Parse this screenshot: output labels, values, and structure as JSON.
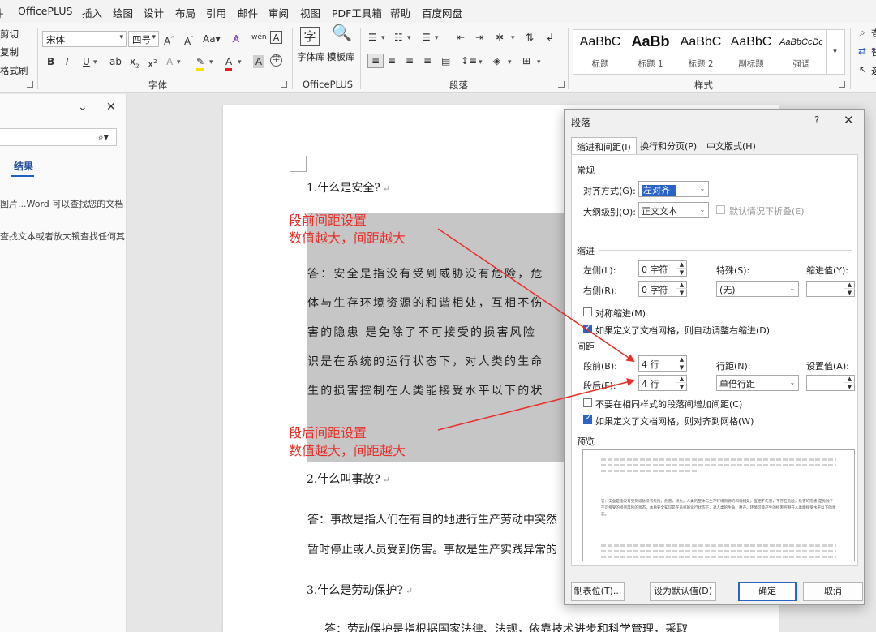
{
  "menu": [
    "件",
    "OfficePLUS",
    "插入",
    "绘图",
    "设计",
    "布局",
    "引用",
    "邮件",
    "审阅",
    "视图",
    "PDF工具箱",
    "帮助",
    "百度网盘"
  ],
  "ribbon": {
    "clipboard": {
      "cut": "剪切",
      "copy": "复制",
      "painter": "格式刷"
    },
    "font": {
      "name": "宋体",
      "size": "四号",
      "group_label": "字体",
      "aa": "Aa"
    },
    "officeplus": {
      "font_lib": "字体库",
      "template_lib": "模板库",
      "group_label": "OfficePLUS",
      "char": "字"
    },
    "paragraph": {
      "group_label": "段落"
    },
    "styles": {
      "group_label": "样式",
      "items": [
        {
          "sample": "AaBbC",
          "name": "标题"
        },
        {
          "sample": "AaBb",
          "name": "标题 1"
        },
        {
          "sample": "AaBbC",
          "name": "标题 2"
        },
        {
          "sample": "AaBbC",
          "name": "副标题"
        },
        {
          "sample": "AaBbCcDc",
          "name": "强调"
        }
      ]
    },
    "editing": {
      "find": "查",
      "replace": "替",
      "select": "选"
    }
  },
  "navpane": {
    "tab_results": "结果",
    "hint1": "图片...Word 可以查找您的文档",
    "hint2": "查找文本或者放大镜查找任何其"
  },
  "document": {
    "q1": "1.什么是安全?",
    "a1_lines": [
      "答：安全是指没有受到威胁没有危险，危",
      "体与生存环境资源的和谐相处，互相不伤",
      "害的隐患  是免除了不可接受的损害风险",
      "识是在系统的运行状态下，对人类的生命",
      "生的损害控制在人类能接受水平以下的状"
    ],
    "q2": "2.什么叫事故?",
    "a2_lines": [
      "答：事故是指人们在有目的地进行生产劳动中突然",
      "暂时停止或人员受到伤害。事故是生产实践异常的"
    ],
    "q3": "3.什么是劳动保护?",
    "a3_line": "答：劳动保护是指根据国家法律、法规，依靠技术进步和科学管理，采取",
    "return_mark": "↵"
  },
  "annotations": {
    "before": [
      "段前间距设置",
      "数值越大，间距越大"
    ],
    "after": [
      "段后间距设置",
      "数值越大，间距越大"
    ]
  },
  "dialog": {
    "title": "段落",
    "help": "?",
    "tabs": [
      "缩进和间距(I)",
      "换行和分页(P)",
      "中文版式(H)"
    ],
    "general": {
      "section": "常规",
      "align_label": "对齐方式(G):",
      "align_value": "左对齐",
      "outline_label": "大纲级别(O):",
      "outline_value": "正文文本",
      "collapse_label": "默认情况下折叠(E)"
    },
    "indent": {
      "section": "缩进",
      "left_label": "左侧(L):",
      "left_value": "0 字符",
      "right_label": "右侧(R):",
      "right_value": "0 字符",
      "special_label": "特殊(S):",
      "special_value": "(无)",
      "indent_by_label": "缩进值(Y):",
      "mirror_label": "对称缩进(M)",
      "auto_right_label": "如果定义了文档网格，则自动调整右缩进(D)"
    },
    "spacing": {
      "section": "间距",
      "before_label": "段前(B):",
      "before_value": "4 行",
      "after_label": "段后(F):",
      "after_value": "4 行",
      "line_label": "行距(N):",
      "line_value": "单倍行距",
      "at_label": "设置值(A):",
      "no_space_label": "不要在相同样式的段落间增加间距(C)",
      "snap_grid_label": "如果定义了文档网格，则对齐到网格(W)"
    },
    "preview": {
      "section": "预览",
      "sample_text": "答：安全是指没有受到威胁没有危险，危害，损失。人类的整体与生存环境资源的和谐相处。互相不伤害，不存在危险，危害的隐患 是免除了不可接受的损害风险的状态。本质安全知识是在系统的运行状态下，对人类的生命、财产、环境可能产生的损害控制在人类能接受水平以下的状态。"
    },
    "buttons": {
      "tabs": "制表位(T)...",
      "default": "设为默认值(D)",
      "ok": "确定",
      "cancel": "取消"
    }
  }
}
